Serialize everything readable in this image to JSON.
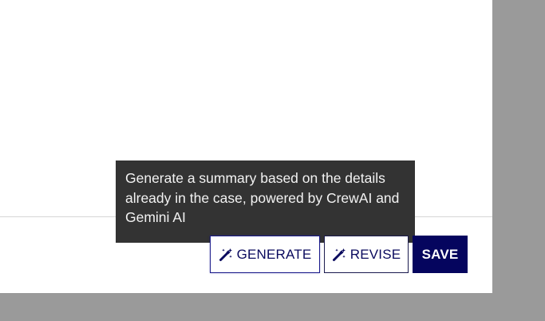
{
  "tooltip": {
    "text": "Generate a summary based on the details already in the case, powered by CrewAI and Gemini AI"
  },
  "actions": {
    "generate_label": "GENERATE",
    "generate_icon": "magic-wand-icon",
    "revise_label": "REVISE",
    "revise_icon": "magic-wand-icon",
    "save_label": "SAVE"
  },
  "colors": {
    "backdrop": "#9a9a9a",
    "dialog_bg": "#ffffff",
    "tooltip_bg": "#333333",
    "primary": "#05055e"
  }
}
